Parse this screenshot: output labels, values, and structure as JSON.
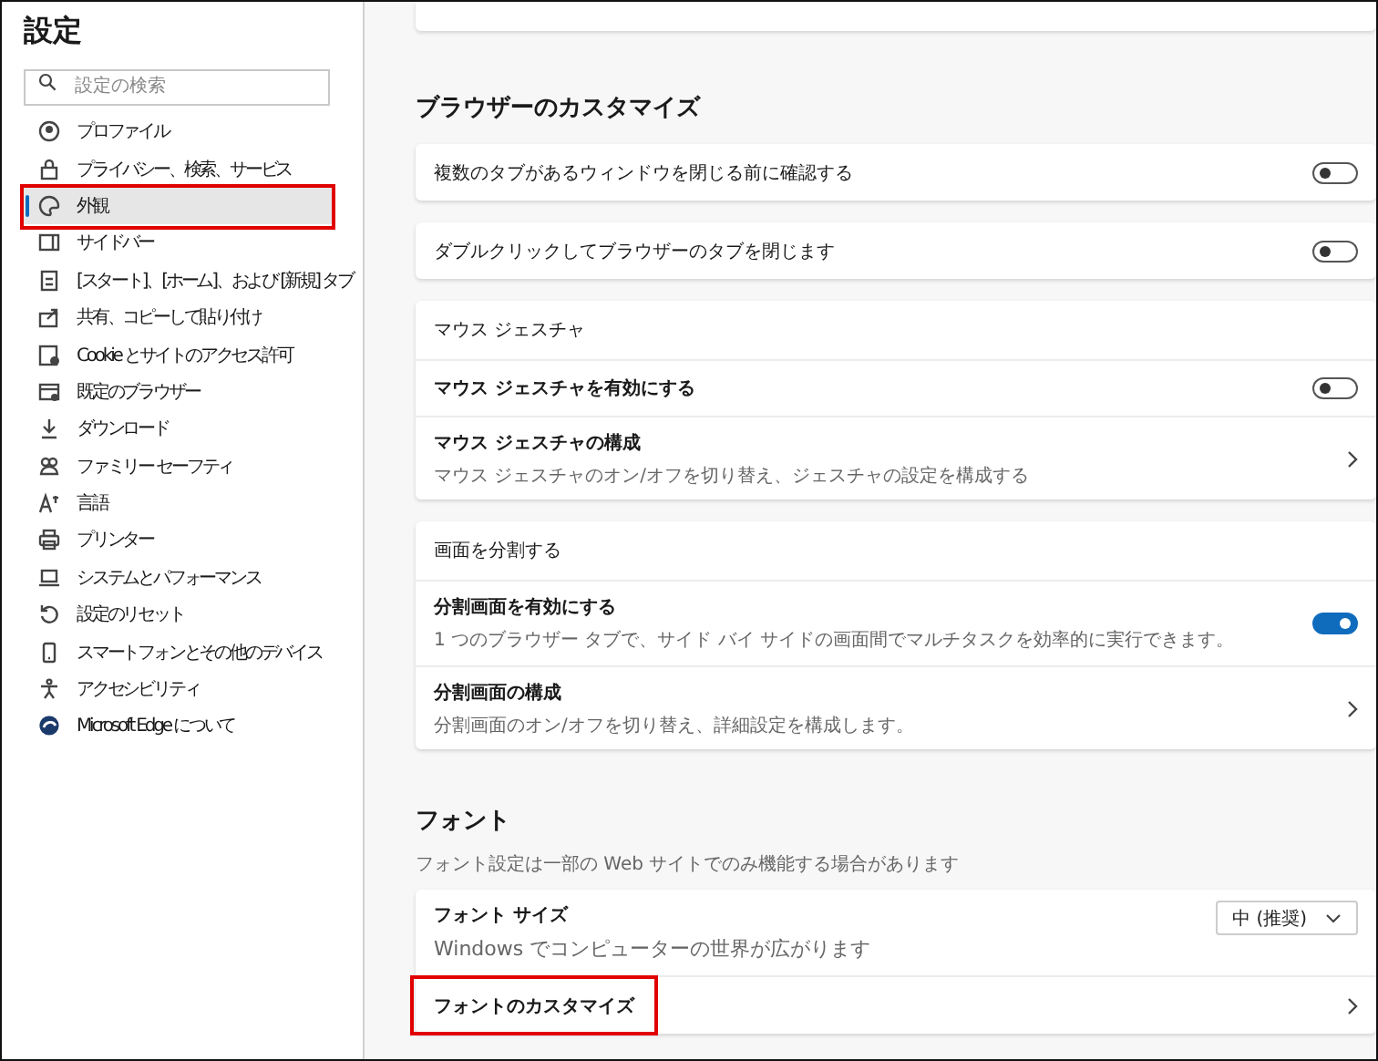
{
  "sidebar": {
    "title": "設定",
    "search": {
      "placeholder": "設定の検索"
    },
    "items": [
      {
        "label": "プロファイル",
        "selected": false,
        "highlighted": false
      },
      {
        "label": "プライバシー、検索、サービス",
        "selected": false,
        "highlighted": false
      },
      {
        "label": "外観",
        "selected": true,
        "highlighted": true
      },
      {
        "label": "サイドバー",
        "selected": false,
        "highlighted": false
      },
      {
        "label": "[スタート]、[ホーム]、および [新規] タブ",
        "selected": false,
        "highlighted": false
      },
      {
        "label": "共有、コピーして貼り付け",
        "selected": false,
        "highlighted": false
      },
      {
        "label": "Cookie とサイトのアクセス許可",
        "selected": false,
        "highlighted": false
      },
      {
        "label": "既定のブラウザー",
        "selected": false,
        "highlighted": false
      },
      {
        "label": "ダウンロード",
        "selected": false,
        "highlighted": false
      },
      {
        "label": "ファミリー セーフティ",
        "selected": false,
        "highlighted": false
      },
      {
        "label": "言語",
        "selected": false,
        "highlighted": false
      },
      {
        "label": "プリンター",
        "selected": false,
        "highlighted": false
      },
      {
        "label": "システムとパフォーマンス",
        "selected": false,
        "highlighted": false
      },
      {
        "label": "設定のリセット",
        "selected": false,
        "highlighted": false
      },
      {
        "label": "スマートフォンとその他のデバイス",
        "selected": false,
        "highlighted": false
      },
      {
        "label": "アクセシビリティ",
        "selected": false,
        "highlighted": false
      },
      {
        "label": "Microsoft Edge について",
        "selected": false,
        "highlighted": false
      }
    ]
  },
  "content": {
    "sections": [
      {
        "heading": "ブラウザーのカスタマイズ",
        "cards": [
          {
            "rows": [
              {
                "kind": "toggle",
                "label": "複数のタブがあるウィンドウを閉じる前に確認する",
                "on": false
              }
            ]
          },
          {
            "rows": [
              {
                "kind": "toggle",
                "label": "ダブルクリックしてブラウザーのタブを閉じます",
                "on": false
              }
            ]
          },
          {
            "rows": [
              {
                "kind": "header",
                "label": "マウス ジェスチャ"
              },
              {
                "kind": "toggle",
                "label": "マウス ジェスチャを有効にする",
                "on": false
              },
              {
                "kind": "link",
                "label": "マウス ジェスチャの構成",
                "description": "マウス ジェスチャのオン/オフを切り替え、ジェスチャの設定を構成する"
              }
            ]
          },
          {
            "rows": [
              {
                "kind": "header",
                "label": "画面を分割する"
              },
              {
                "kind": "toggle",
                "label": "分割画面を有効にする",
                "description": "1 つのブラウザー タブで、サイド バイ サイドの画面間でマルチタスクを効率的に実行できます。",
                "on": true
              },
              {
                "kind": "link",
                "label": "分割画面の構成",
                "description": "分割画面のオン/オフを切り替え、詳細設定を構成します。"
              }
            ]
          }
        ]
      },
      {
        "heading": "フォント",
        "description": "フォント設定は一部の Web サイトでのみ機能する場合があります",
        "cards": [
          {
            "rows": [
              {
                "kind": "select",
                "label": "フォント サイズ",
                "description": "Windows でコンピューターの世界が広がります",
                "value": "中 (推奨)"
              },
              {
                "kind": "link",
                "label": "フォントのカスタマイズ",
                "highlighted": true
              }
            ]
          }
        ]
      }
    ]
  }
}
